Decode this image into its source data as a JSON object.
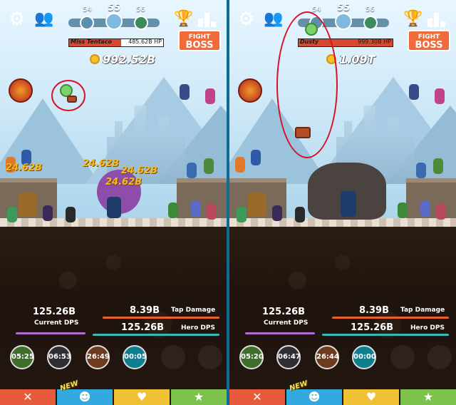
{
  "panels": [
    {
      "stages": {
        "prev": "54",
        "current": "55",
        "next": "56"
      },
      "boss": {
        "name": "Miss Tentaco",
        "hp": "485.62B HP",
        "hp_fraction": 0.55
      },
      "fight_button": {
        "line1": "FIGHT",
        "line2": "BOSS"
      },
      "gold": "992.52B",
      "damage_popups": [
        "24.62B",
        "24.62B",
        "24.62B",
        "24.62B"
      ],
      "stats": {
        "current_dps_value": "125.26B",
        "current_dps_label": "Current DPS",
        "tap_damage_value": "8.39B",
        "tap_damage_label": "Tap Damage",
        "hero_dps_value": "125.26B",
        "hero_dps_label": "Hero DPS"
      },
      "skill_timers": [
        "05:25",
        "06:53",
        "26:49",
        "00:05"
      ]
    },
    {
      "stages": {
        "prev": "54",
        "current": "55",
        "next": "56"
      },
      "boss": {
        "name": "Dusty",
        "hp": "999.30B HP",
        "hp_fraction": 1.0
      },
      "fight_button": {
        "line1": "FIGHT",
        "line2": "BOSS"
      },
      "gold": "1.09T",
      "stats": {
        "current_dps_value": "125.26B",
        "current_dps_label": "Current DPS",
        "tap_damage_value": "8.39B",
        "tap_damage_label": "Tap Damage",
        "hero_dps_value": "125.26B",
        "hero_dps_label": "Hero DPS"
      },
      "skill_timers": [
        "05:20",
        "06:47",
        "26:44",
        "00:00"
      ]
    }
  ],
  "tabs": {
    "new_badge": "NEW",
    "icons": [
      "sword-icon",
      "heroes-icon",
      "heart-icon",
      "star-icon"
    ]
  },
  "colors": {
    "fight_boss": "#f06a3a",
    "boss_hp_fill": "#d4492f",
    "annotation": "#d8102a"
  }
}
